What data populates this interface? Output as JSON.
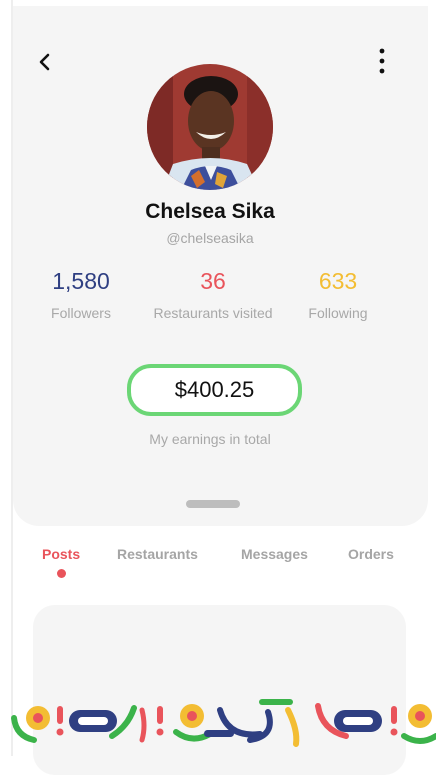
{
  "header": {
    "back_icon": "chevron-left-icon",
    "more_icon": "vertical-ellipsis-icon"
  },
  "profile": {
    "name": "Chelsea Sika",
    "handle": "@chelseasika",
    "avatar": "profile-photo"
  },
  "stats": [
    {
      "value": "1,580",
      "label": "Followers",
      "color": "#2f3f82"
    },
    {
      "value": "36",
      "label": "Restaurants visited",
      "color": "#e9545b"
    },
    {
      "value": "633",
      "label": "Following",
      "color": "#f3bd33"
    }
  ],
  "earnings": {
    "amount": "$400.25",
    "label": "My earnings in total",
    "accent": "#6bd675"
  },
  "tabs": [
    {
      "label": "Posts",
      "active": true
    },
    {
      "label": "Restaurants",
      "active": false
    },
    {
      "label": "Messages",
      "active": false
    },
    {
      "label": "Orders",
      "active": false
    }
  ],
  "colors": {
    "red": "#e9545b",
    "navy": "#2f3f82",
    "yellow": "#f3bd33",
    "green": "#3bb34a"
  }
}
